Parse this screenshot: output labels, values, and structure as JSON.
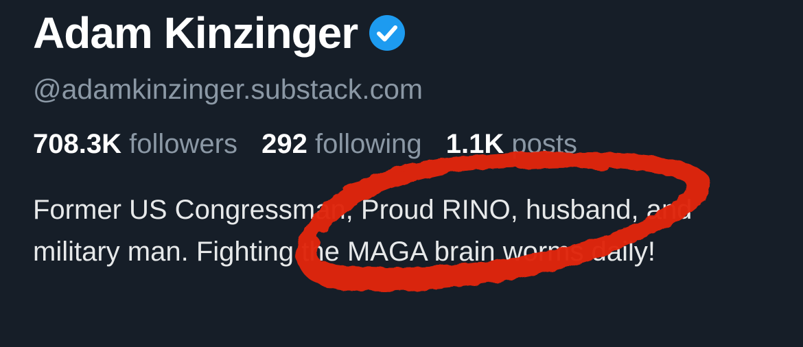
{
  "profile": {
    "name": "Adam Kinzinger",
    "handle": "@adamkinzinger.substack.com",
    "verified_icon": "verified-check-icon",
    "bio": "Former US Congressman, Proud RINO, husband, and military man. Fighting the MAGA brain worms daily!"
  },
  "stats": {
    "followers_count": "708.3K",
    "followers_label": "followers",
    "following_count": "292",
    "following_label": "following",
    "posts_count": "1.1K",
    "posts_label": "posts"
  },
  "colors": {
    "background": "#161e28",
    "verified": "#1d9bf0",
    "secondary_text": "#8b98a5",
    "annotation": "#e0260f"
  },
  "annotation": {
    "type": "red-marker-circle",
    "encircles": "Proud RINO"
  }
}
